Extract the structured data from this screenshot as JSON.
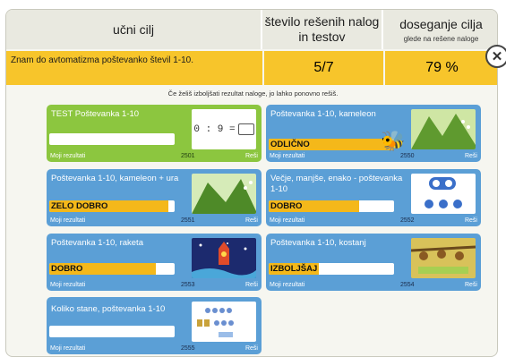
{
  "header": {
    "col1": "učni cilj",
    "col2": "število rešenih nalog in testov",
    "col3": "doseganje cilja",
    "col3_sub": "glede na rešene naloge"
  },
  "goal": {
    "text": "Znam do avtomatizma poštevanko števil 1-10.",
    "solved": "5/7",
    "percent": "79 %"
  },
  "close_icon": "close-icon",
  "note": "Če želiš izboljšati rezultat naloge, jo lahko ponovno rešiš.",
  "colors": {
    "blue_card": "#5b9fd6",
    "green_card": "#8cc63f",
    "accent": "#f7c52b",
    "bar_fill": "#f4b81a"
  },
  "cards": [
    {
      "title": "TEST Poštevanka 1-10",
      "status": "",
      "progress": 0,
      "id": "2501",
      "my_results": "Moji rezultati",
      "solve": "Reši",
      "thumb_text": "0 : 9 ="
    },
    {
      "title": "Poštevanka 1-10, kameleon",
      "status": "ODLIČNO",
      "progress": 1.0,
      "id": "2550",
      "my_results": "Moji rezultati",
      "solve": "Reši"
    },
    {
      "title": "Poštevanka 1-10, kameleon + ura",
      "status": "ZELO DOBRO",
      "progress": 0.95,
      "id": "2551",
      "my_results": "Moji rezultati",
      "solve": "Reši"
    },
    {
      "title": "Večje, manjše, enako - poštevanka 1-10",
      "status": "DOBRO",
      "progress": 0.72,
      "id": "2552",
      "my_results": "Moji rezultati",
      "solve": "Reši"
    },
    {
      "title": "Poštevanka 1-10, raketa",
      "status": "DOBRO",
      "progress": 0.85,
      "id": "2553",
      "my_results": "Moji rezultati",
      "solve": "Reši"
    },
    {
      "title": "Poštevanka 1-10, kostanj",
      "status": "IZBOLJŠAJ",
      "progress": 0.4,
      "id": "2554",
      "my_results": "Moji rezultati",
      "solve": "Reši"
    },
    {
      "title": "Koliko stane, poštevanka 1-10",
      "status": "",
      "progress": 0,
      "id": "2555",
      "my_results": "Moji rezultati",
      "solve": "Reši"
    }
  ]
}
